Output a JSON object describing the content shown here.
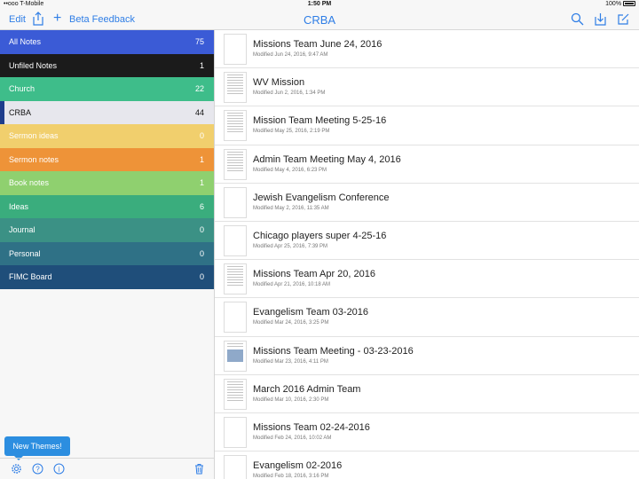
{
  "status_bar": {
    "carrier": "••ooo T-Mobile",
    "time": "1:50 PM",
    "battery": "100%"
  },
  "nav": {
    "edit": "Edit",
    "beta": "Beta Feedback",
    "title": "CRBA",
    "icons": [
      "share-icon",
      "plus-icon",
      "search-icon",
      "download-icon",
      "compose-icon"
    ]
  },
  "notebooks": [
    {
      "label": "All Notes",
      "count": "75",
      "color": "#3b5bd6"
    },
    {
      "label": "Unfiled Notes",
      "count": "1",
      "color": "#1b1b1b"
    },
    {
      "label": "Church",
      "count": "22",
      "color": "#3ebd8a"
    },
    {
      "label": "CRBA",
      "count": "44",
      "color": "#e7e7ed",
      "selected": true
    },
    {
      "label": "Sermon ideas",
      "count": "0",
      "color": "#f1cf6d"
    },
    {
      "label": "Sermon notes",
      "count": "1",
      "color": "#ee9338"
    },
    {
      "label": "Book notes",
      "count": "1",
      "color": "#8fd06f"
    },
    {
      "label": "Ideas",
      "count": "6",
      "color": "#3aad7d"
    },
    {
      "label": "Journal",
      "count": "0",
      "color": "#3b9185"
    },
    {
      "label": "Personal",
      "count": "0",
      "color": "#2f7186"
    },
    {
      "label": "FIMC Board",
      "count": "0",
      "color": "#1f4e7a"
    }
  ],
  "toast": "New Themes!",
  "sidebar_toolbar_icons": [
    "gear-icon",
    "help-icon",
    "info-icon",
    "trash-icon"
  ],
  "notes": [
    {
      "title": "Missions Team June 24, 2016",
      "modified": "Modified Jun 24, 2016, 9:47 AM",
      "thumb": "blank"
    },
    {
      "title": "WV Mission",
      "modified": "Modified Jun 2, 2016, 1:34 PM",
      "thumb": "text"
    },
    {
      "title": "Mission Team Meeting 5-25-16",
      "modified": "Modified May 25, 2016, 2:19 PM",
      "thumb": "text"
    },
    {
      "title": "Admin Team Meeting May 4, 2016",
      "modified": "Modified May 4, 2016, 6:23 PM",
      "thumb": "text"
    },
    {
      "title": "Jewish Evangelism Conference",
      "modified": "Modified May 2, 2016, 11:35 AM",
      "thumb": "blank"
    },
    {
      "title": "Chicago players super 4-25-16",
      "modified": "Modified Apr 25, 2016, 7:39 PM",
      "thumb": "blank"
    },
    {
      "title": "Missions Team Apr 20, 2016",
      "modified": "Modified Apr 21, 2016, 10:18 AM",
      "thumb": "text"
    },
    {
      "title": "Evangelism Team 03-2016",
      "modified": "Modified Mar 24, 2016, 3:25 PM",
      "thumb": "blank"
    },
    {
      "title": "Missions Team Meeting - 03-23-2016",
      "modified": "Modified Mar 23, 2016, 4:11 PM",
      "thumb": "image"
    },
    {
      "title": "March 2016 Admin Team",
      "modified": "Modified Mar 10, 2016, 2:30 PM",
      "thumb": "text"
    },
    {
      "title": "Missions Team 02-24-2016",
      "modified": "Modified Feb 24, 2016, 10:02 AM",
      "thumb": "blank"
    },
    {
      "title": "Evangelism 02-2016",
      "modified": "Modified Feb 18, 2016, 3:16 PM",
      "thumb": "blank"
    }
  ]
}
